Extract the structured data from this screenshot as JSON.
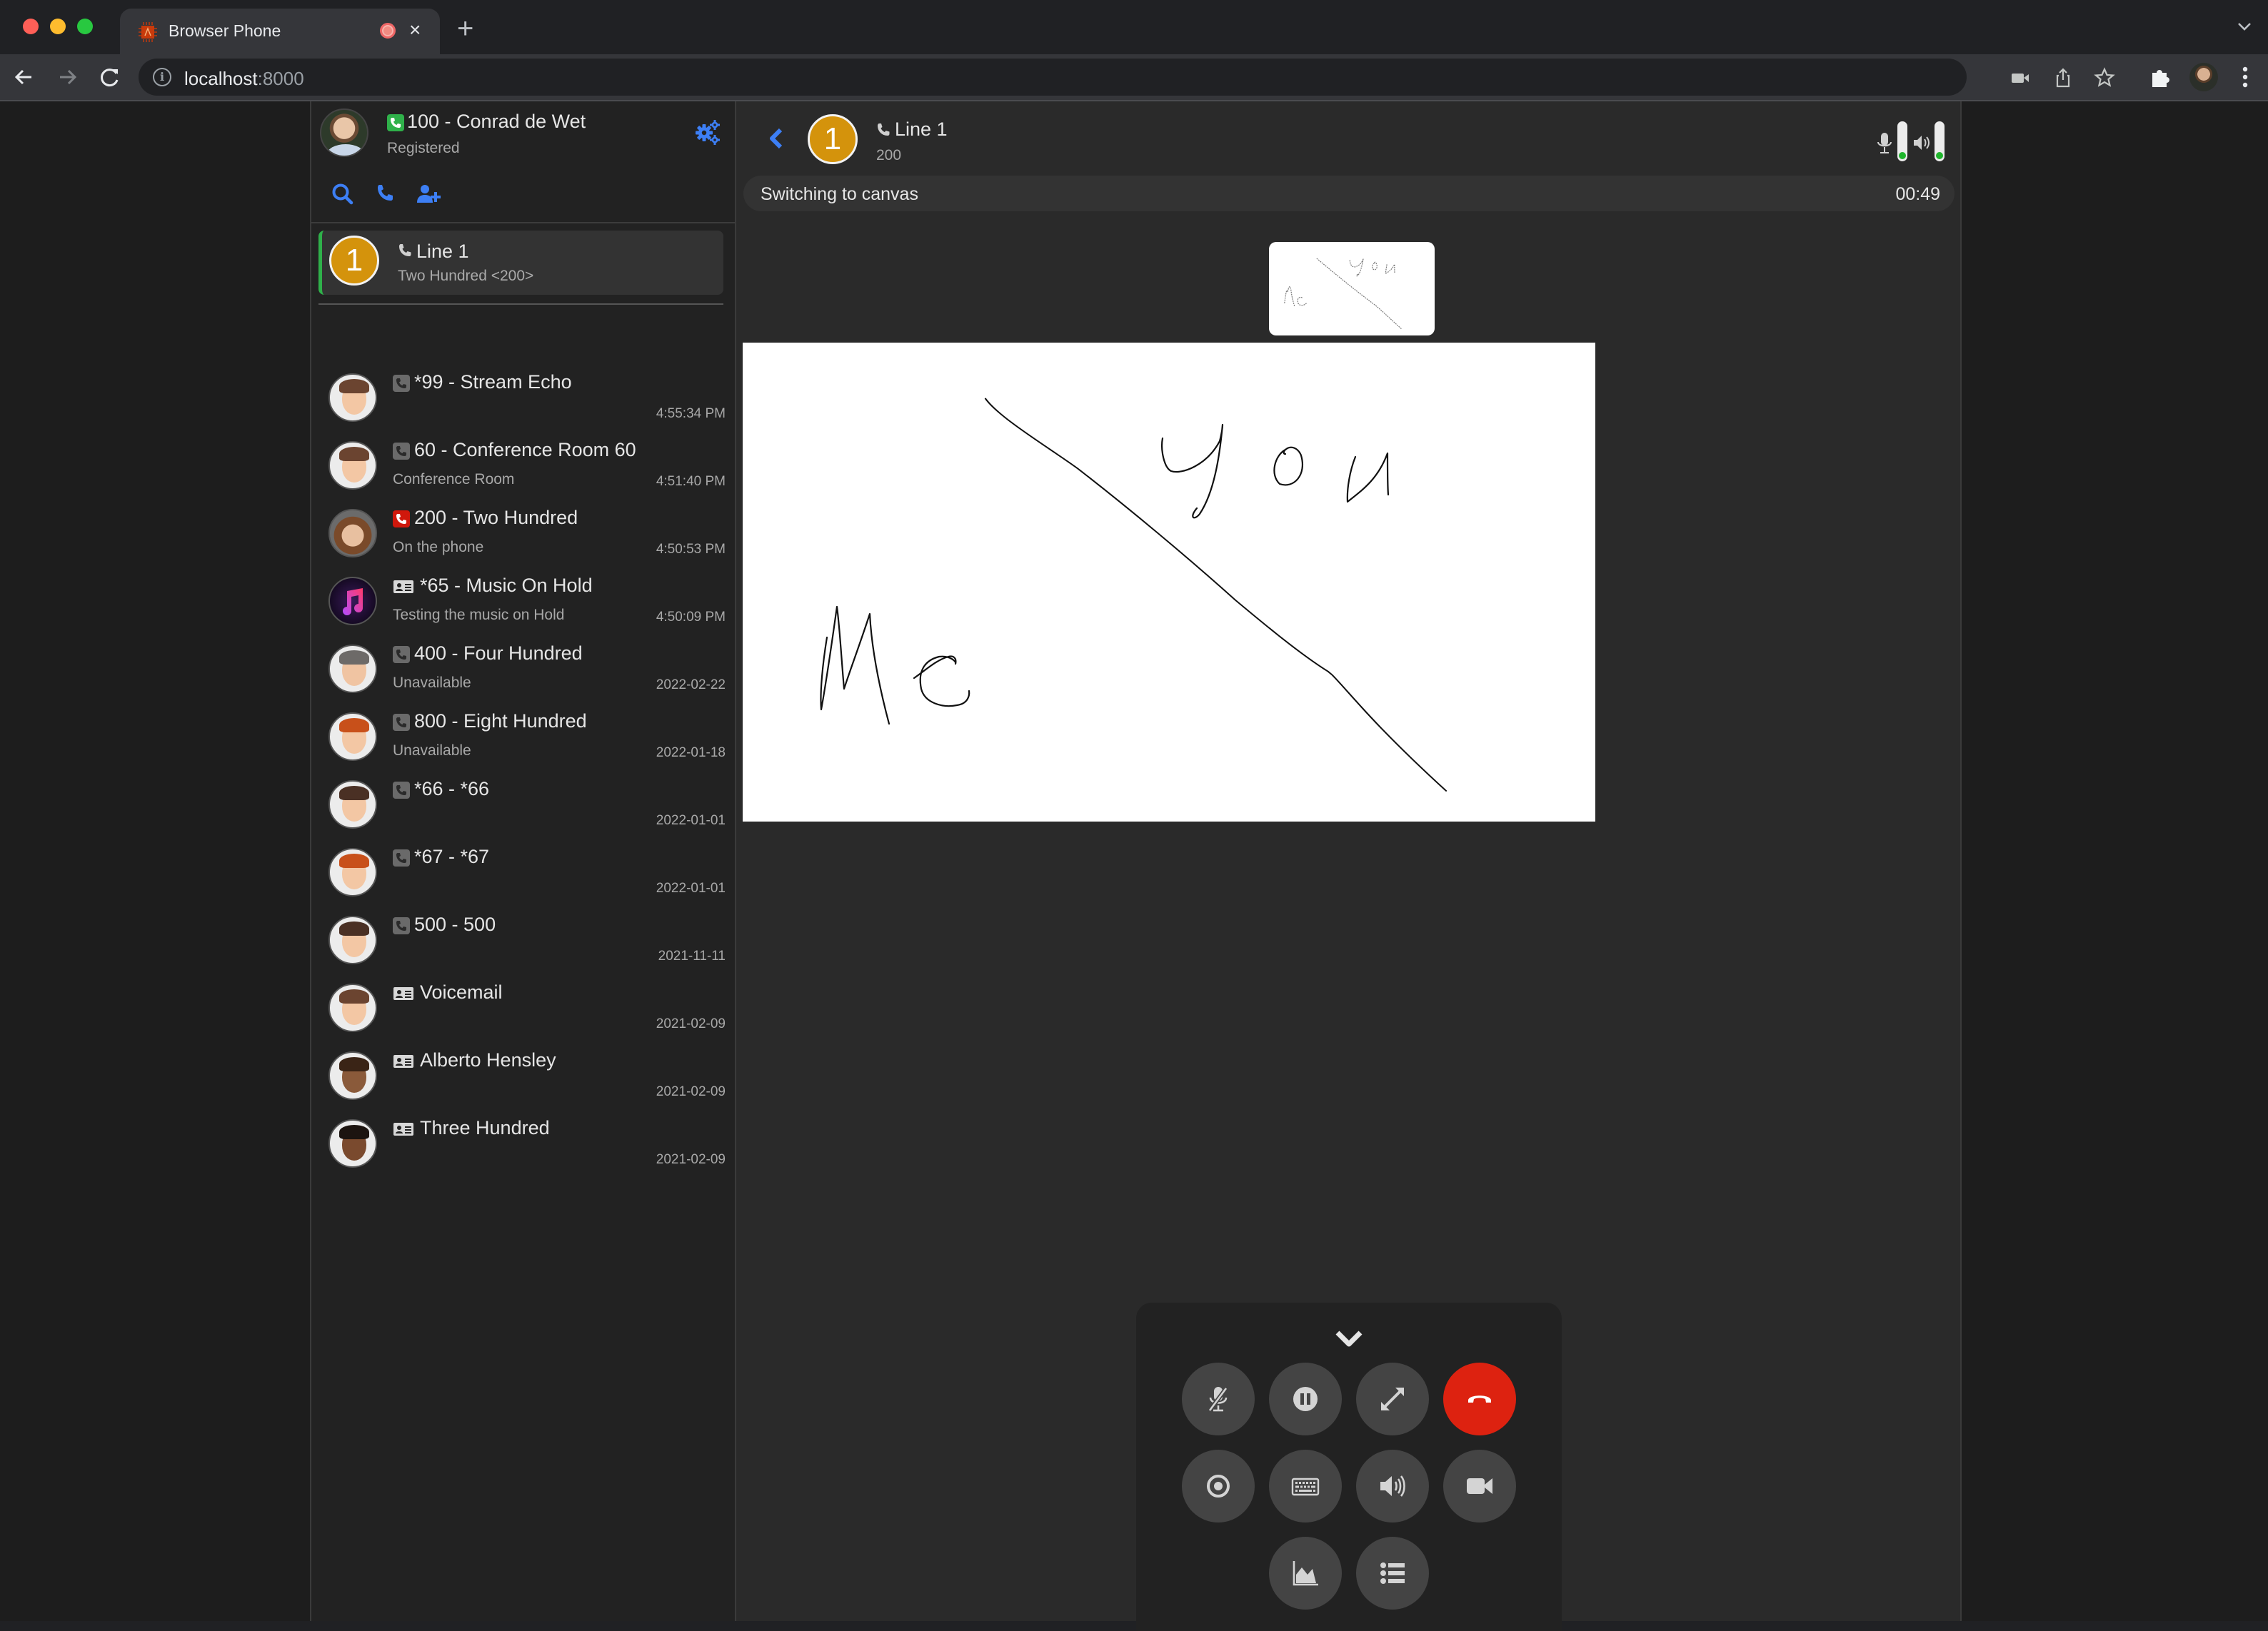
{
  "browser": {
    "tab_title": "Browser Phone",
    "new_tab_label": "+",
    "close_label": "×",
    "url_host": "localhost",
    "url_port": ":8000",
    "colors": {
      "close": "#ff5f57",
      "minimize": "#febc2e",
      "maximize": "#28c840"
    }
  },
  "profile": {
    "name": "100 - Conrad de Wet",
    "status": "Registered",
    "status_color": "#2fb14a",
    "accent": "#3d7ff5"
  },
  "active_line": {
    "number": "1",
    "title": "Line 1",
    "subtitle": "Two Hundred <200>",
    "badge_color": "#d4930c"
  },
  "contacts": [
    {
      "name": "*99 - Stream Echo",
      "sub": "",
      "time": "4:55:34 PM",
      "icon": "phone-icon",
      "status": "grey"
    },
    {
      "name": "60 - Conference Room 60",
      "sub": "Conference Room",
      "time": "4:51:40 PM",
      "icon": "phone-icon",
      "status": "grey"
    },
    {
      "name": "200 - Two Hundred",
      "sub": "On the phone",
      "time": "4:50:53 PM",
      "icon": "phone-icon",
      "status": "red"
    },
    {
      "name": "*65 - Music On Hold",
      "sub": "Testing the music on Hold",
      "time": "4:50:09 PM",
      "icon": "contact-card-icon",
      "status": "card"
    },
    {
      "name": "400 - Four Hundred",
      "sub": "Unavailable",
      "time": "2022-02-22",
      "icon": "phone-icon",
      "status": "grey"
    },
    {
      "name": "800 - Eight Hundred",
      "sub": "Unavailable",
      "time": "2022-01-18",
      "icon": "phone-icon",
      "status": "grey"
    },
    {
      "name": "*66 - *66",
      "sub": "",
      "time": "2022-01-01",
      "icon": "phone-icon",
      "status": "grey"
    },
    {
      "name": "*67 - *67",
      "sub": "",
      "time": "2022-01-01",
      "icon": "phone-icon",
      "status": "grey"
    },
    {
      "name": "500 - 500",
      "sub": "",
      "time": "2021-11-11",
      "icon": "phone-icon",
      "status": "grey"
    },
    {
      "name": "Voicemail",
      "sub": "",
      "time": "2021-02-09",
      "icon": "contact-card-icon",
      "status": "card"
    },
    {
      "name": "Alberto Hensley",
      "sub": "",
      "time": "2021-02-09",
      "icon": "contact-card-icon",
      "status": "card"
    },
    {
      "name": "Three Hundred",
      "sub": "",
      "time": "2021-02-09",
      "icon": "contact-card-icon",
      "status": "card"
    }
  ],
  "call": {
    "line_number": "1",
    "title": "Line 1",
    "number": "200",
    "status_text": "Switching to canvas",
    "timer": "00:49",
    "mic_level": 0.1,
    "speaker_level": 0.1,
    "canvas_text": [
      "You",
      "Me"
    ]
  },
  "controls": {
    "buttons": [
      {
        "name": "mute-button",
        "icon": "microphone-slash-icon"
      },
      {
        "name": "hold-button",
        "icon": "pause-circle-icon"
      },
      {
        "name": "expand-button",
        "icon": "expand-arrows-icon"
      },
      {
        "name": "hangup-button",
        "icon": "phone-hangup-icon"
      },
      {
        "name": "record-button",
        "icon": "record-dot-icon"
      },
      {
        "name": "dtmf-keypad-button",
        "icon": "keyboard-icon"
      },
      {
        "name": "audio-devices-button",
        "icon": "volume-icon"
      },
      {
        "name": "video-button",
        "icon": "video-camera-icon"
      },
      {
        "name": "call-stats-button",
        "icon": "area-chart-icon"
      },
      {
        "name": "call-timeline-button",
        "icon": "list-icon"
      }
    ],
    "hangup_color": "#dd2210"
  }
}
